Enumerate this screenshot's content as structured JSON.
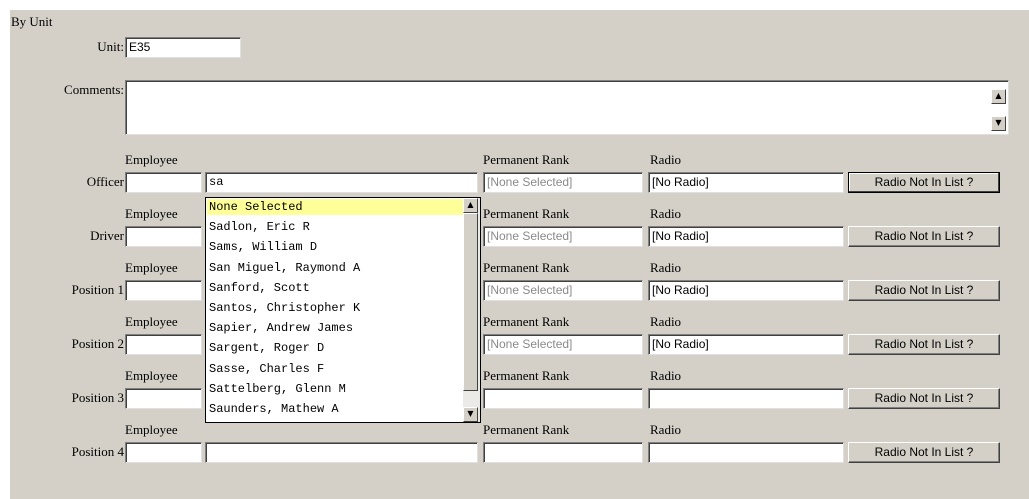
{
  "section_title": "By Unit",
  "unit": {
    "label": "Unit:",
    "value": "E35"
  },
  "comments": {
    "label": "Comments:",
    "value": ""
  },
  "column_headers": {
    "employee": "Employee",
    "rank": "Permanent Rank",
    "radio": "Radio"
  },
  "button_label": "Radio Not In List ?",
  "rows": [
    {
      "label": "Officer",
      "employee_id": "",
      "employee_name": "sa",
      "rank": "[None Selected]",
      "radio": "[No Radio]"
    },
    {
      "label": "Driver",
      "employee_id": "",
      "employee_name": "",
      "rank": "[None Selected]",
      "radio": "[No Radio]"
    },
    {
      "label": "Position 1",
      "employee_id": "",
      "employee_name": "",
      "rank": "[None Selected]",
      "radio": "[No Radio]"
    },
    {
      "label": "Position 2",
      "employee_id": "",
      "employee_name": "",
      "rank": "[None Selected]",
      "radio": "[No Radio]"
    },
    {
      "label": "Position 3",
      "employee_id": "",
      "employee_name": "",
      "rank": "",
      "radio": ""
    },
    {
      "label": "Position 4",
      "employee_id": "",
      "employee_name": "",
      "rank": "",
      "radio": ""
    }
  ],
  "autocomplete": {
    "selected_index": 0,
    "options": [
      "None Selected",
      "Sadlon, Eric R",
      "Sams, William D",
      "San Miguel, Raymond A",
      "Sanford, Scott",
      "Santos, Christopher K",
      "Sapier, Andrew James",
      "Sargent, Roger D",
      "Sasse, Charles F",
      "Sattelberg, Glenn M",
      "Saunders, Mathew A"
    ]
  },
  "icons": {
    "scroll_up": "scroll-up-arrow-icon",
    "scroll_down": "scroll-down-arrow-icon"
  },
  "colors": {
    "panel": "#d4d0c8",
    "selected_option": "#ffff99",
    "gray_text": "#8a8a8a"
  }
}
